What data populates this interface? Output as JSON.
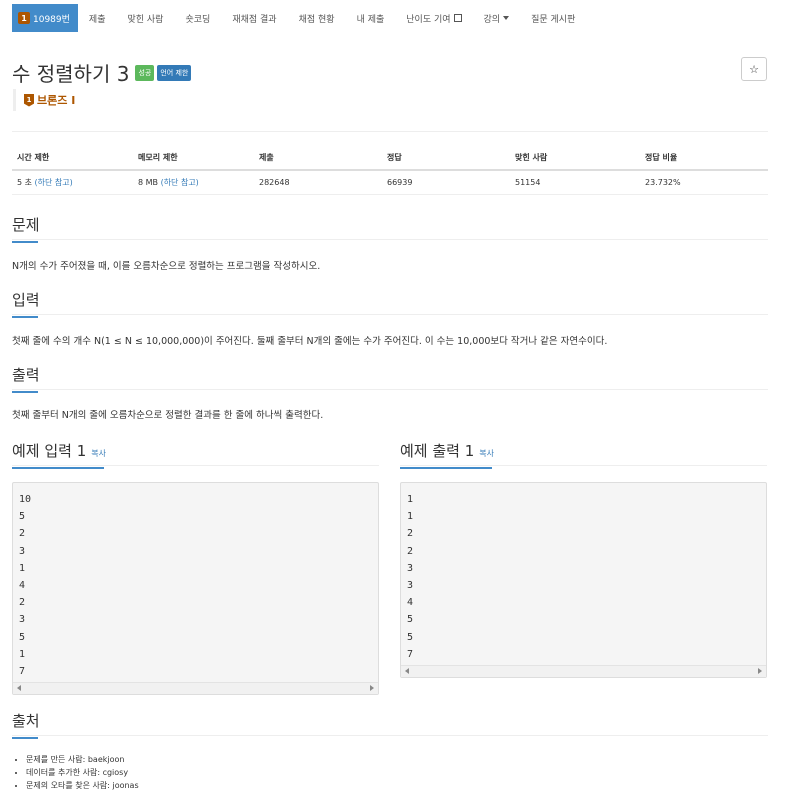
{
  "nav": {
    "problem_number": "10989번",
    "tier_badge": "1",
    "items": [
      "제출",
      "맞힌 사람",
      "숏코딩",
      "재채점 결과",
      "채점 현황",
      "내 제출",
      "난이도 기여",
      "강의",
      "질문 게시판"
    ]
  },
  "problem": {
    "title": "수 정렬하기 3",
    "label_success": "성공",
    "label_lang": "언어 제한",
    "star": "☆",
    "tier_number": "1",
    "tier_name": "브론즈 I"
  },
  "info_table": {
    "headers": [
      "시간 제한",
      "메모리 제한",
      "제출",
      "정답",
      "맞힌 사람",
      "정답 비율"
    ],
    "time_limit": "5 초",
    "memory_limit": "8 MB",
    "limit_note": "(하단 참고)",
    "submissions": "282648",
    "correct": "66939",
    "solvers": "51154",
    "ratio": "23.732%"
  },
  "sections": {
    "problem_title": "문제",
    "problem_text": "N개의 수가 주어졌을 때, 이를 오름차순으로 정렬하는 프로그램을 작성하시오.",
    "input_title": "입력",
    "input_text": "첫째 줄에 수의 개수 N(1 ≤ N ≤ 10,000,000)이 주어진다. 둘째 줄부터 N개의 줄에는 수가 주어진다. 이 수는 10,000보다 작거나 같은 자연수이다.",
    "output_title": "출력",
    "output_text": "첫째 줄부터 N개의 줄에 오름차순으로 정렬한 결과를 한 줄에 하나씩 출력한다."
  },
  "examples": {
    "input_title": "예제 입력 1",
    "output_title": "예제 출력 1",
    "copy_label": "복사",
    "input_lines": "10\n5\n2\n3\n1\n4\n2\n3\n5\n1\n7",
    "output_lines": "1\n1\n2\n2\n3\n3\n4\n5\n5\n7"
  },
  "source": {
    "title": "출처",
    "items": [
      "문제를 만든 사람: baekjoon",
      "데이터를 추가한 사람: cgiosy",
      "문제의 오타를 찾은 사람: joonas"
    ]
  },
  "colors": {
    "nav_active": "#428bca",
    "bronze": "#ad5600",
    "label_green": "#5cb85c",
    "label_blue": "#337ab7"
  }
}
